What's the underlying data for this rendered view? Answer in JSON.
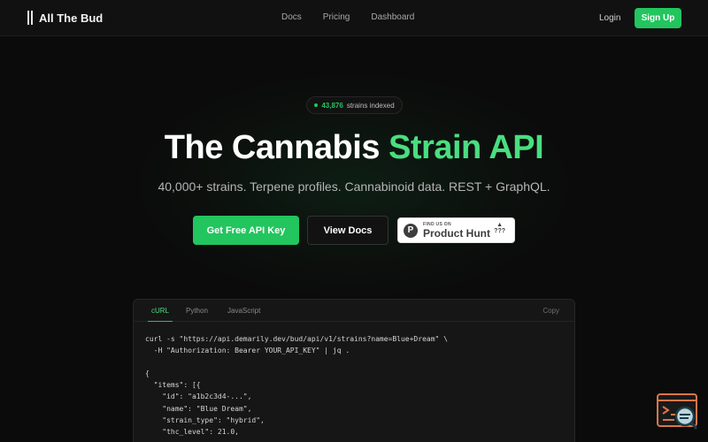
{
  "nav": {
    "brand": "All The Bud",
    "links": [
      "Docs",
      "Pricing",
      "Dashboard"
    ],
    "login": "Login",
    "signup": "Sign Up"
  },
  "hero": {
    "pill_count": "43,876",
    "pill_text": "strains indexed",
    "title_main": "The Cannabis ",
    "title_accent": "Strain API",
    "subtitle": "40,000+ strains. Terpene profiles. Cannabinoid data. REST + GraphQL.",
    "cta_primary": "Get Free API Key",
    "cta_secondary": "View Docs",
    "badge": {
      "logo_letter": "P",
      "small_text": "FIND US ON",
      "big_text": "Product Hunt",
      "arrow": "▲",
      "votes": "???"
    }
  },
  "code": {
    "tabs": [
      "cURL",
      "Python",
      "JavaScript"
    ],
    "active_tab": "cURL",
    "copy": "Copy",
    "lines": [
      "curl -s \"https://api.demarily.dev/bud/api/v1/strains?name=Blue+Dream\" \\",
      "  -H \"Authorization: Bearer YOUR_API_KEY\" | jq .",
      "",
      "{",
      "  \"items\": [{",
      "    \"id\": \"a1b2c3d4-...\",",
      "    \"name\": \"Blue Dream\",",
      "    \"strain_type\": \"hybrid\",",
      "    \"thc_level\": 21.0,"
    ]
  },
  "colors": {
    "accent": "#22c55e",
    "accent_text": "#4ade80",
    "background": "#0b0b0b"
  },
  "icons": {
    "brand": "bars-logo-icon",
    "status_dot": "status-dot-icon",
    "widget": "terminal-search-icon"
  }
}
